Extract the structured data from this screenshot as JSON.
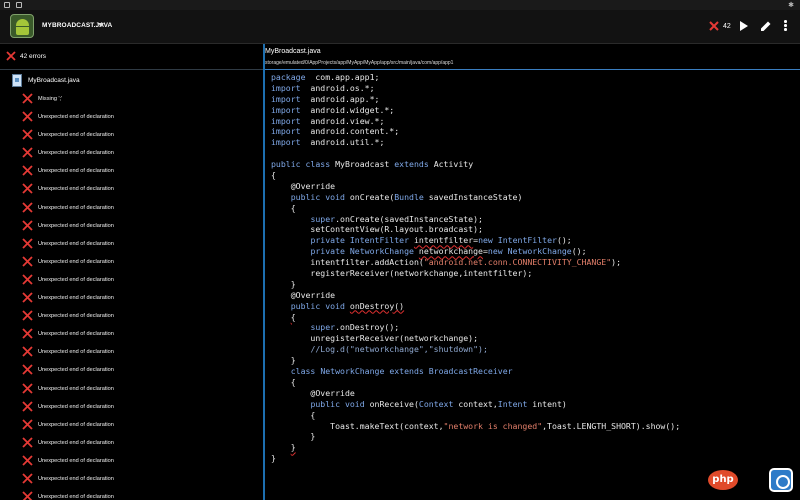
{
  "app_bar": {
    "file_title": "MYBROADCAST.JAVA",
    "error_count": "42"
  },
  "errors_panel": {
    "header": "42 errors",
    "file": "MyBroadcast.java",
    "items": [
      "Missing ';'",
      "Unexpected end of declaration",
      "Unexpected end of declaration",
      "Unexpected end of declaration",
      "Unexpected end of declaration",
      "Unexpected end of declaration",
      "Unexpected end of declaration",
      "Unexpected end of declaration",
      "Unexpected end of declaration",
      "Unexpected end of declaration",
      "Unexpected end of declaration",
      "Unexpected end of declaration",
      "Unexpected end of declaration",
      "Unexpected end of declaration",
      "Unexpected end of declaration",
      "Unexpected end of declaration",
      "Unexpected end of declaration",
      "Unexpected end of declaration",
      "Unexpected end of declaration",
      "Unexpected end of declaration",
      "Unexpected end of declaration",
      "Unexpected end of declaration",
      "Unexpected end of declaration",
      "Unexpected end of declaration"
    ]
  },
  "editor": {
    "file_name": "MyBroadcast.java",
    "file_path": "storage/emulated/0/AppProjects/app/MyApp/MyApp/app/src/main/java/com/app/app1"
  },
  "code_lines": [
    [
      [
        "kw",
        "package"
      ],
      [
        "",
        "  com.app.app1;"
      ]
    ],
    [
      [
        "kw",
        "import"
      ],
      [
        "",
        "  android.os.*;"
      ]
    ],
    [
      [
        "kw",
        "import"
      ],
      [
        "",
        "  android.app.*;"
      ]
    ],
    [
      [
        "kw",
        "import"
      ],
      [
        "",
        "  android.widget.*;"
      ]
    ],
    [
      [
        "kw",
        "import"
      ],
      [
        "",
        "  android.view.*;"
      ]
    ],
    [
      [
        "kw",
        "import"
      ],
      [
        "",
        "  android.content.*;"
      ]
    ],
    [
      [
        "kw",
        "import"
      ],
      [
        "",
        "  android.util.*;"
      ]
    ],
    [
      [
        "",
        ""
      ]
    ],
    [
      [
        "kw",
        "public class"
      ],
      [
        "",
        " MyBroadcast "
      ],
      [
        "kw",
        "extends"
      ],
      [
        "",
        " Activity"
      ]
    ],
    [
      [
        "",
        "{"
      ]
    ],
    [
      [
        "",
        "    @Override"
      ]
    ],
    [
      [
        "",
        "    "
      ],
      [
        "kw",
        "public void"
      ],
      [
        "",
        " onCreate("
      ],
      [
        "kw",
        "Bundle"
      ],
      [
        "",
        " savedInstanceState)"
      ]
    ],
    [
      [
        "",
        "    {"
      ]
    ],
    [
      [
        "",
        "        "
      ],
      [
        "kw",
        "super"
      ],
      [
        "",
        ".onCreate(savedInstanceState);"
      ]
    ],
    [
      [
        "",
        "        setContentView(R.layout.broadcast);"
      ]
    ],
    [
      [
        "",
        "        "
      ],
      [
        "kw",
        "private IntentFilter"
      ],
      [
        "",
        " "
      ],
      [
        "sq",
        "intentfilter"
      ],
      [
        "",
        "="
      ],
      [
        "kw",
        "new"
      ],
      [
        "",
        " "
      ],
      [
        "kw",
        "IntentFilter"
      ],
      [
        "",
        "();"
      ]
    ],
    [
      [
        "",
        "        "
      ],
      [
        "kw",
        "private NetworkChange"
      ],
      [
        "",
        " "
      ],
      [
        "sq",
        "networkchange"
      ],
      [
        "",
        "="
      ],
      [
        "kw",
        "new"
      ],
      [
        "",
        " "
      ],
      [
        "kw",
        "NetworkChange"
      ],
      [
        "",
        "();"
      ]
    ],
    [
      [
        "",
        "        intentfilter.addAction("
      ],
      [
        "st",
        "\"android.net.conn.CONNECTIVITY_CHANGE\""
      ],
      [
        "",
        ");"
      ]
    ],
    [
      [
        "",
        "        registerReceiver(networkchange,intentfilter);"
      ]
    ],
    [
      [
        "",
        "    }"
      ]
    ],
    [
      [
        "",
        "    @Override"
      ]
    ],
    [
      [
        "",
        "    "
      ],
      [
        "kw",
        "public void"
      ],
      [
        "",
        " "
      ],
      [
        "sq",
        "onDestroy()"
      ]
    ],
    [
      [
        "",
        "    "
      ],
      [
        "sq",
        "{"
      ]
    ],
    [
      [
        "",
        "        "
      ],
      [
        "kw",
        "super"
      ],
      [
        "",
        ".onDestroy();"
      ]
    ],
    [
      [
        "",
        "        unregisterReceiver(networkchange);"
      ]
    ],
    [
      [
        "",
        "        "
      ],
      [
        "cm",
        "//Log.d(\"networkchange\",\"shutdown\");"
      ]
    ],
    [
      [
        "",
        "    }"
      ]
    ],
    [
      [
        "",
        "    "
      ],
      [
        "kw",
        "class"
      ],
      [
        "",
        " "
      ],
      [
        "kw",
        "NetworkChange extends BroadcastReceiver"
      ]
    ],
    [
      [
        "",
        "    {"
      ]
    ],
    [
      [
        "",
        "        @Override"
      ]
    ],
    [
      [
        "",
        "        "
      ],
      [
        "kw",
        "public void"
      ],
      [
        "",
        " onReceive("
      ],
      [
        "kw",
        "Context"
      ],
      [
        "",
        " context,"
      ],
      [
        "kw",
        "Intent"
      ],
      [
        "",
        " intent)"
      ]
    ],
    [
      [
        "",
        "        {"
      ]
    ],
    [
      [
        "",
        "            Toast.makeText(context,"
      ],
      [
        "st",
        "\"network is changed\""
      ],
      [
        "",
        ",Toast.LENGTH_SHORT).show();"
      ]
    ],
    [
      [
        "",
        "        }"
      ]
    ],
    [
      [
        "",
        "    "
      ],
      [
        "sq",
        "}"
      ]
    ],
    [
      [
        "",
        "}"
      ]
    ]
  ],
  "watermark": "php"
}
